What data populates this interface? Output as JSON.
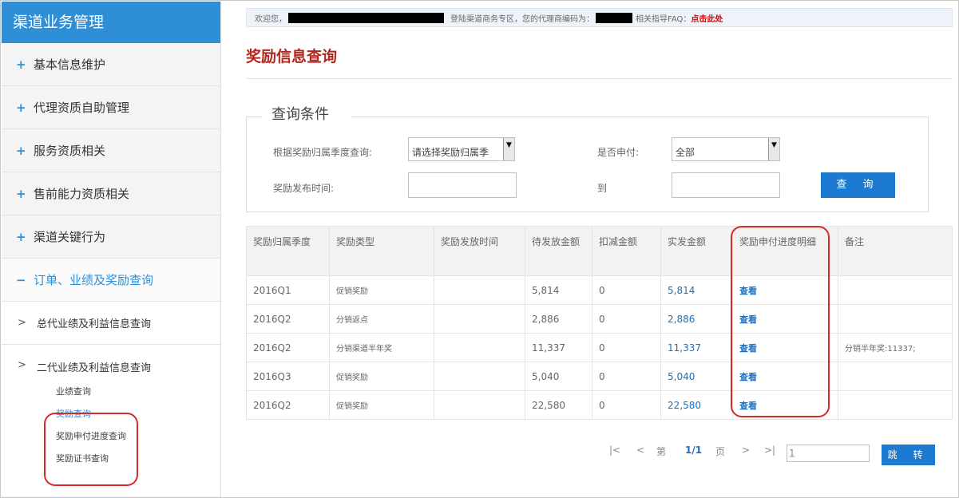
{
  "sidebar": {
    "title": "渠道业务管理",
    "items": [
      {
        "mark": "+",
        "label": "基本信息维护"
      },
      {
        "mark": "+",
        "label": "代理资质自助管理"
      },
      {
        "mark": "+",
        "label": "服务资质相关"
      },
      {
        "mark": "+",
        "label": "售前能力资质相关"
      },
      {
        "mark": "+",
        "label": "渠道关键行为"
      },
      {
        "mark": "−",
        "label": "订单、业绩及奖励查询"
      }
    ],
    "sub_items": [
      {
        "mark": ">",
        "label": "总代业绩及利益信息查询"
      },
      {
        "mark": ">",
        "label": "二代业绩及利益信息查询"
      }
    ],
    "leaves": [
      "业绩查询",
      "奖励查询",
      "奖励申付进度查询",
      "奖励证书查询"
    ]
  },
  "topbar": {
    "welcome": "欢迎您，",
    "login_text": "登陆渠道商务专区，您的代理商编码为：",
    "faq_text": "相关指导FAQ：",
    "faq_link": "点击此处"
  },
  "page_title": "奖励信息查询",
  "query": {
    "legend": "查询条件",
    "season_label": "根据奖励归属季度查询:",
    "season_value": "请选择奖励归属季",
    "paid_label": "是否申付:",
    "paid_value": "全部",
    "time_label": "奖励发布时间:",
    "to_label": "到",
    "search_button": "查 询"
  },
  "table": {
    "headers": [
      "奖励归属季度",
      "奖励类型",
      "奖励发放时间",
      "待发放金额",
      "扣减金额",
      "实发金额",
      "奖励申付进度明细",
      "备注"
    ],
    "rows": [
      {
        "season": "2016Q1",
        "type": "促销奖励",
        "time": "",
        "pending": "5,814",
        "deduct": "0",
        "actual": "5,814",
        "detail": "查看",
        "note": ""
      },
      {
        "season": "2016Q2",
        "type": "分销返点",
        "time": "",
        "pending": "2,886",
        "deduct": "0",
        "actual": "2,886",
        "detail": "查看",
        "note": ""
      },
      {
        "season": "2016Q2",
        "type": "分销渠道半年奖",
        "time": "",
        "pending": "11,337",
        "deduct": "0",
        "actual": "11,337",
        "detail": "查看",
        "note": "分销半年奖:11337;"
      },
      {
        "season": "2016Q3",
        "type": "促销奖励",
        "time": "",
        "pending": "5,040",
        "deduct": "0",
        "actual": "5,040",
        "detail": "查看",
        "note": ""
      },
      {
        "season": "2016Q2",
        "type": "促销奖励",
        "time": "",
        "pending": "22,580",
        "deduct": "0",
        "actual": "22,580",
        "detail": "查看",
        "note": ""
      }
    ]
  },
  "pager": {
    "first": "|<",
    "prev": "<",
    "page_prefix": "第",
    "current": "1/1",
    "page_suffix": "页",
    "next": ">",
    "last": ">|",
    "jump_value": "1",
    "jump_button": "跳 转"
  },
  "colors": {
    "accent": "#2f8fd6",
    "title_red": "#b3261e",
    "highlight_red": "#d72b2b",
    "button_blue": "#1d7ad1"
  }
}
